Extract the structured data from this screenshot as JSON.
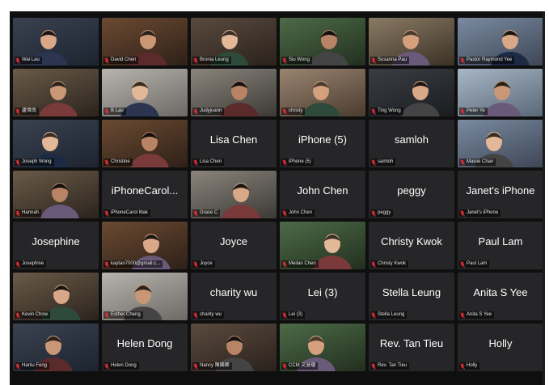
{
  "colors": {
    "background": "#0f0f10",
    "tile": "#262628",
    "active_speaker_border": "#34c759",
    "muted_mic": "#e0303a"
  },
  "participants": [
    {
      "label": "Wai Lau",
      "video": true,
      "active": true
    },
    {
      "label": "David Chen",
      "video": true
    },
    {
      "label": "Bronia Leung",
      "video": true
    },
    {
      "label": "Siu Wong",
      "video": true
    },
    {
      "label": "Susanna Pau",
      "video": true
    },
    {
      "label": "Pastor Raymond Yee",
      "video": true
    },
    {
      "label": "盧偉南",
      "video": true
    },
    {
      "label": "B Lau",
      "video": true
    },
    {
      "label": "Judyjoann",
      "video": true
    },
    {
      "label": "christy",
      "video": true
    },
    {
      "label": "Ting Wong",
      "video": true
    },
    {
      "label": "Peter Ye",
      "video": true
    },
    {
      "label": "Joseph Wong",
      "video": true
    },
    {
      "label": "Christine",
      "video": true
    },
    {
      "label": "Lisa Chen",
      "display": "Lisa Chen",
      "video": false
    },
    {
      "label": "iPhone (5)",
      "display": "iPhone (5)",
      "video": false
    },
    {
      "label": "samloh",
      "display": "samloh",
      "video": false
    },
    {
      "label": "Maisie Chan",
      "video": true
    },
    {
      "label": "Hannah",
      "video": true
    },
    {
      "label": "iPhoneCarol Mak",
      "display": "iPhoneCarol...",
      "video": false
    },
    {
      "label": "Grace C",
      "video": true
    },
    {
      "label": "John Chen",
      "display": "John Chen",
      "video": false
    },
    {
      "label": "peggy",
      "display": "peggy",
      "video": false
    },
    {
      "label": "Janet's iPhone",
      "display": "Janet's iPhone",
      "video": false
    },
    {
      "label": "Josephine",
      "display": "Josephine",
      "video": false
    },
    {
      "label": "kaytan7000@gmail.c...",
      "video": true
    },
    {
      "label": "Joyce",
      "display": "Joyce",
      "video": false
    },
    {
      "label": "Meilan Chen",
      "video": true
    },
    {
      "label": "Christy Kwok",
      "display": "Christy Kwok",
      "video": false
    },
    {
      "label": "Paul Lam",
      "display": "Paul Lam",
      "video": false
    },
    {
      "label": "Kevin Chow",
      "video": true
    },
    {
      "label": "Esther Cheng",
      "video": true
    },
    {
      "label": "charity wu",
      "display": "charity wu",
      "video": false
    },
    {
      "label": "Lei (3)",
      "display": "Lei (3)",
      "video": false
    },
    {
      "label": "Stella Leung",
      "display": "Stella Leung",
      "video": false
    },
    {
      "label": "Anita S Yee",
      "display": "Anita S Yee",
      "video": false
    },
    {
      "label": "Hanlu Feng",
      "video": true
    },
    {
      "label": "Helen Dong",
      "display": "Helen Dong",
      "video": false
    },
    {
      "label": "Nancy 陳國卿",
      "video": true
    },
    {
      "label": "CCM 文慧瓊",
      "video": true
    },
    {
      "label": "Rev. Tan Tieu",
      "display": "Rev. Tan Tieu",
      "video": false
    },
    {
      "label": "Holly",
      "display": "Holly",
      "video": false
    }
  ]
}
